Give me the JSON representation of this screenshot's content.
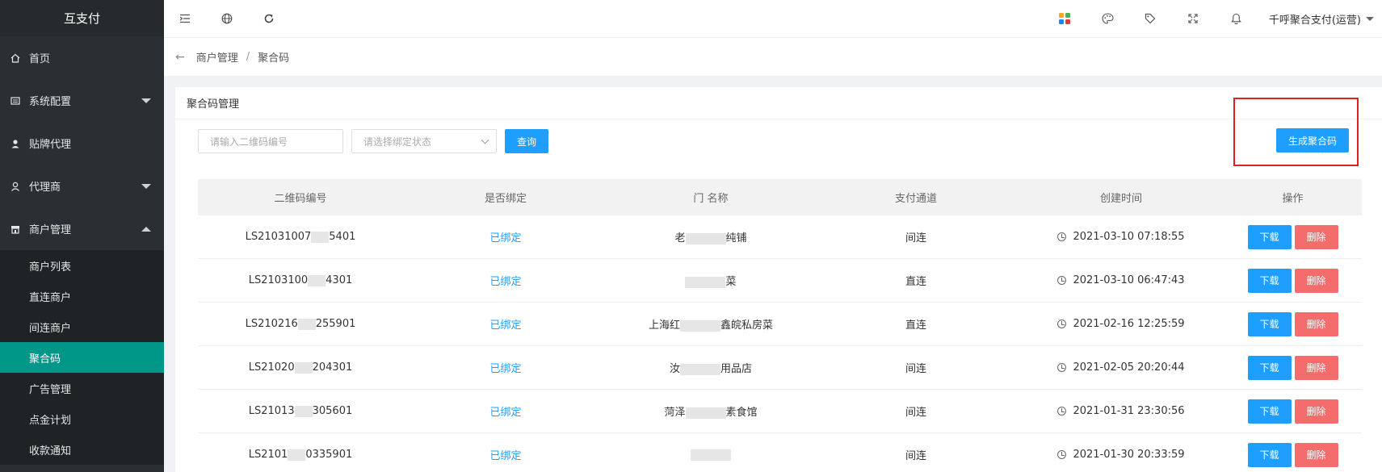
{
  "app": {
    "name": "互支付"
  },
  "sidebar": {
    "items": [
      {
        "label": "首页",
        "icon": "home-icon"
      },
      {
        "label": "系统配置",
        "icon": "settings-icon"
      },
      {
        "label": "贴牌代理",
        "icon": "person-icon"
      },
      {
        "label": "代理商",
        "icon": "user-icon"
      },
      {
        "label": "商户管理",
        "icon": "store-icon"
      }
    ],
    "sub_items": [
      "商户列表",
      "直连商户",
      "间连商户",
      "聚合码",
      "广告管理",
      "点金计划",
      "收款通知"
    ]
  },
  "topbar": {
    "icons": [
      "menu-toggle-icon",
      "globe-icon",
      "refresh-icon"
    ],
    "right_icons": [
      "apps-icon",
      "palette-icon",
      "tag-icon",
      "fullscreen-icon",
      "bell-icon"
    ],
    "user": "千呼聚合支付(运营)"
  },
  "breadcrumb": {
    "items": [
      "商户管理",
      "聚合码"
    ],
    "separator": "/"
  },
  "card": {
    "title": "聚合码管理",
    "search_placeholder": "请输入二维码编号",
    "status_placeholder": "请选择绑定状态",
    "query_label": "查询",
    "generate_label": "生成聚合码"
  },
  "table": {
    "headers": [
      "二维码编号",
      "是否绑定",
      "门  名称",
      "支付通道",
      "创建时间",
      "操作"
    ],
    "rows": [
      {
        "code_a": "LS21031007",
        "code_b": "5401",
        "bound": "已绑定",
        "name_a": "老",
        "name_b": "纯铺",
        "channel": "间连",
        "time": "2021-03-10 07:18:55"
      },
      {
        "code_a": "LS2103100",
        "code_b": "4301",
        "bound": "已绑定",
        "name_a": "",
        "name_b": "菜",
        "channel": "直连",
        "time": "2021-03-10 06:47:43"
      },
      {
        "code_a": "LS210216",
        "code_b": "255901",
        "bound": "已绑定",
        "name_a": "上海红",
        "name_b": "鑫皖私房菜",
        "channel": "直连",
        "time": "2021-02-16 12:25:59"
      },
      {
        "code_a": "LS21020",
        "code_b": "204301",
        "bound": "已绑定",
        "name_a": "汝",
        "name_b": "用品店",
        "channel": "间连",
        "time": "2021-02-05 20:20:44"
      },
      {
        "code_a": "LS21013",
        "code_b": "305601",
        "bound": "已绑定",
        "name_a": "菏泽",
        "name_b": "素食馆",
        "channel": "间连",
        "time": "2021-01-31 23:30:56"
      },
      {
        "code_a": "LS2101",
        "code_b": "0335901",
        "bound": "已绑定",
        "name_a": "",
        "name_b": "",
        "channel": "间连",
        "time": "2021-01-30 20:33:59"
      }
    ],
    "download_label": "下载",
    "delete_label": "删除"
  },
  "colors": {
    "sidebar_bg": "#2a2f33",
    "active": "#009688",
    "primary": "#1e9fff",
    "danger": "#f56c6c",
    "highlight": "#e02020"
  }
}
